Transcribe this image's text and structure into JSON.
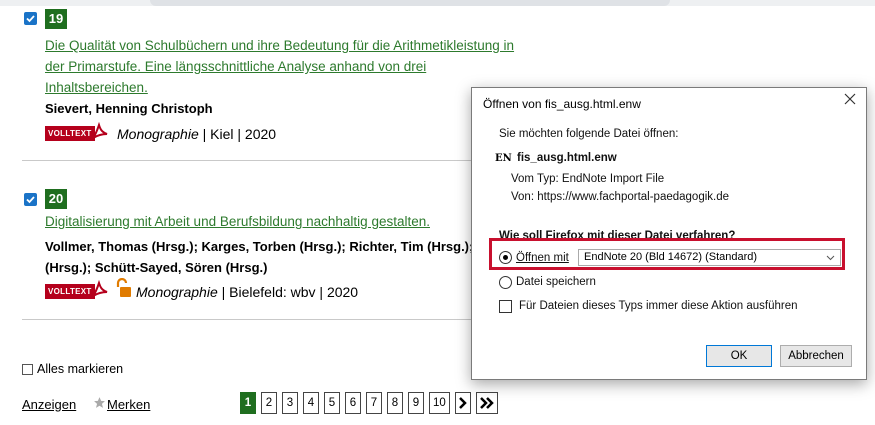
{
  "results": [
    {
      "number": "19",
      "title_lines": [
        "Die Qualität von Schulbüchern und ihre Bedeutung für die Arithmetikleistung in",
        "der Primarstufe. Eine längsschnittliche Analyse anhand von drei",
        "Inhaltsbereichen."
      ],
      "authors": "Sievert, Henning Christoph",
      "volltext": "VOLLTEXT",
      "type": "Monographie",
      "details": " | Kiel | 2020"
    },
    {
      "number": "20",
      "title_lines": [
        "Digitalisierung mit Arbeit und Berufsbildung nachhaltig gestalten."
      ],
      "authors_lines": [
        "Vollmer, Thomas (Hrsg.); Karges, Torben (Hrsg.); Richter, Tim (Hrsg.); Sc",
        "(Hrsg.); Schütt-Sayed, Sören (Hrsg.)"
      ],
      "volltext": "VOLLTEXT",
      "type": "Monographie",
      "details": " | Bielefeld: wbv | 2020"
    }
  ],
  "footer": {
    "mark_all": "Alles markieren",
    "show": "Anzeigen",
    "remember": "Merken"
  },
  "pagination": {
    "pages": [
      "1",
      "2",
      "3",
      "4",
      "5",
      "6",
      "7",
      "8",
      "9",
      "10"
    ],
    "next": "›",
    "last": "»",
    "active": "1"
  },
  "dialog": {
    "title": "Öffnen von fis_ausg.html.enw",
    "close": "✕",
    "intro": "Sie möchten folgende Datei öffnen:",
    "file_badge": "EN",
    "file_name": "fis_ausg.html.enw",
    "type_line": "Vom Typ: EndNote Import File",
    "from_line": "Von: https://www.fachportal-paedagogik.de",
    "question": "Wie soll Firefox mit dieser Datei verfahren?",
    "open_with": "Öffnen mit",
    "open_with_app": "EndNote 20 (Bld 14672) (Standard)",
    "save_file": "Datei speichern",
    "always_do": "Für Dateien dieses Typs immer diese Aktion ausführen",
    "ok": "OK",
    "cancel": "Abbrechen"
  },
  "colors": {
    "accent_green": "#1f6e1f",
    "link_green": "#2d7a2d",
    "volltext_red": "#b5001c",
    "highlight_red": "#c8102e",
    "lock_orange": "#e07b00"
  }
}
